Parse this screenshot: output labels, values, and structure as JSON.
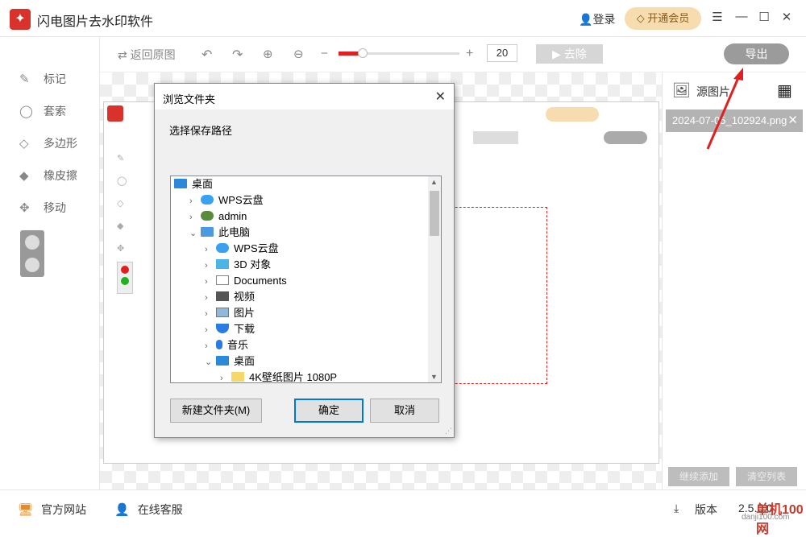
{
  "app": {
    "title": "闪电图片去水印软件",
    "logo_glyph": "✦",
    "login": "登录",
    "vip": "开通会员"
  },
  "window": {
    "min": "☰",
    "minimize": "—",
    "maximize": "☐",
    "close": "✕"
  },
  "sidebar": {
    "items": [
      {
        "label": "标记",
        "icon": "pen-icon"
      },
      {
        "label": "套索",
        "icon": "lasso-icon"
      },
      {
        "label": "多边形",
        "icon": "polygon-icon"
      },
      {
        "label": "橡皮擦",
        "icon": "eraser-icon"
      },
      {
        "label": "移动",
        "icon": "move-icon"
      }
    ]
  },
  "toolbar": {
    "restore": "返回原图",
    "zoom_value": "20",
    "remove": "▶ 去除",
    "export": "导出"
  },
  "right_panel": {
    "source_label": "源图片",
    "file_name": "2024-07-05_102924.png",
    "btn_continue": "继续添加",
    "btn_clear": "清空列表"
  },
  "bottom": {
    "website": "官方网站",
    "support": "在线客服",
    "version_label": "版本",
    "version": "2.5.5.0"
  },
  "dialog": {
    "title": "浏览文件夹",
    "prompt": "选择保存路径",
    "tree": [
      {
        "label": "桌面",
        "indent": 0,
        "expand": "",
        "icon": "desktop"
      },
      {
        "label": "WPS云盘",
        "indent": 1,
        "expand": ">",
        "icon": "cloud"
      },
      {
        "label": "admin",
        "indent": 1,
        "expand": ">",
        "icon": "user"
      },
      {
        "label": "此电脑",
        "indent": 1,
        "expand": "v",
        "icon": "computer"
      },
      {
        "label": "WPS云盘",
        "indent": 2,
        "expand": ">",
        "icon": "cloud"
      },
      {
        "label": "3D 对象",
        "indent": 2,
        "expand": ">",
        "icon": "cube"
      },
      {
        "label": "Documents",
        "indent": 2,
        "expand": ">",
        "icon": "doc"
      },
      {
        "label": "视频",
        "indent": 2,
        "expand": ">",
        "icon": "video"
      },
      {
        "label": "图片",
        "indent": 2,
        "expand": ">",
        "icon": "picture"
      },
      {
        "label": "下载",
        "indent": 2,
        "expand": ">",
        "icon": "download"
      },
      {
        "label": "音乐",
        "indent": 2,
        "expand": ">",
        "icon": "music"
      },
      {
        "label": "桌面",
        "indent": 2,
        "expand": "v",
        "icon": "desktop"
      },
      {
        "label": "4K壁纸图片 1080P",
        "indent": 3,
        "expand": ">",
        "icon": "folder"
      }
    ],
    "new_folder": "新建文件夹(M)",
    "ok": "确定",
    "cancel": "取消"
  },
  "watermark": {
    "site": "单机100网",
    "url": "danji100.com"
  },
  "colors": {
    "accent": "#e02020",
    "vip_bg": "#f6dcae",
    "arrow": "#e02020"
  }
}
